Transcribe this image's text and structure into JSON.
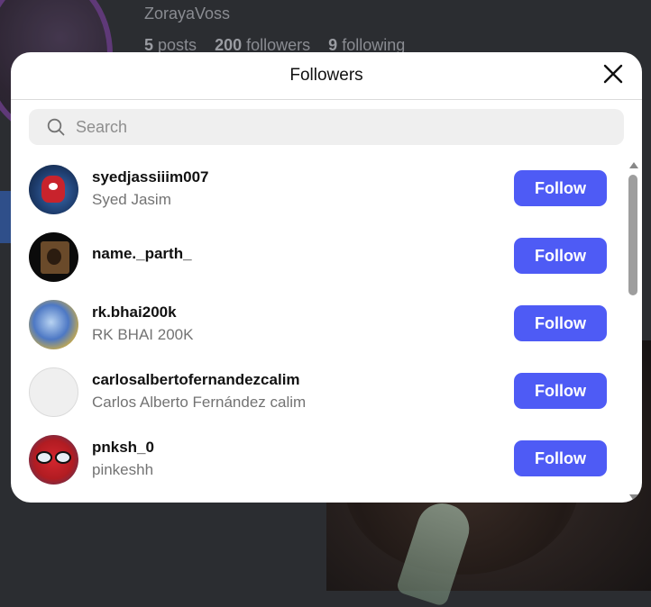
{
  "background": {
    "username": "ZorayaVoss",
    "stats": {
      "posts_count": "5",
      "posts_label": "posts",
      "followers_count": "200",
      "followers_label": "followers",
      "following_count": "9",
      "following_label": "following"
    }
  },
  "modal": {
    "title": "Followers",
    "search_placeholder": "Search",
    "search_value": "",
    "followers": [
      {
        "username": "syedjassiiim007",
        "fullname": "Syed Jasim",
        "button": "Follow"
      },
      {
        "username": "name._parth_",
        "fullname": "",
        "button": "Follow"
      },
      {
        "username": "rk.bhai200k",
        "fullname": "RK BHAI 200K",
        "button": "Follow"
      },
      {
        "username": "carlosalbertofernandezcalim",
        "fullname": "Carlos Alberto Fernández calim",
        "button": "Follow"
      },
      {
        "username": "pnksh_0",
        "fullname": "pinkeshh",
        "button": "Follow"
      }
    ]
  },
  "colors": {
    "follow_button": "#4e5bf5",
    "modal_background": "#ffffff",
    "page_background": "#2b2d31"
  },
  "icons": {
    "close": "close-icon",
    "search": "search-icon"
  }
}
